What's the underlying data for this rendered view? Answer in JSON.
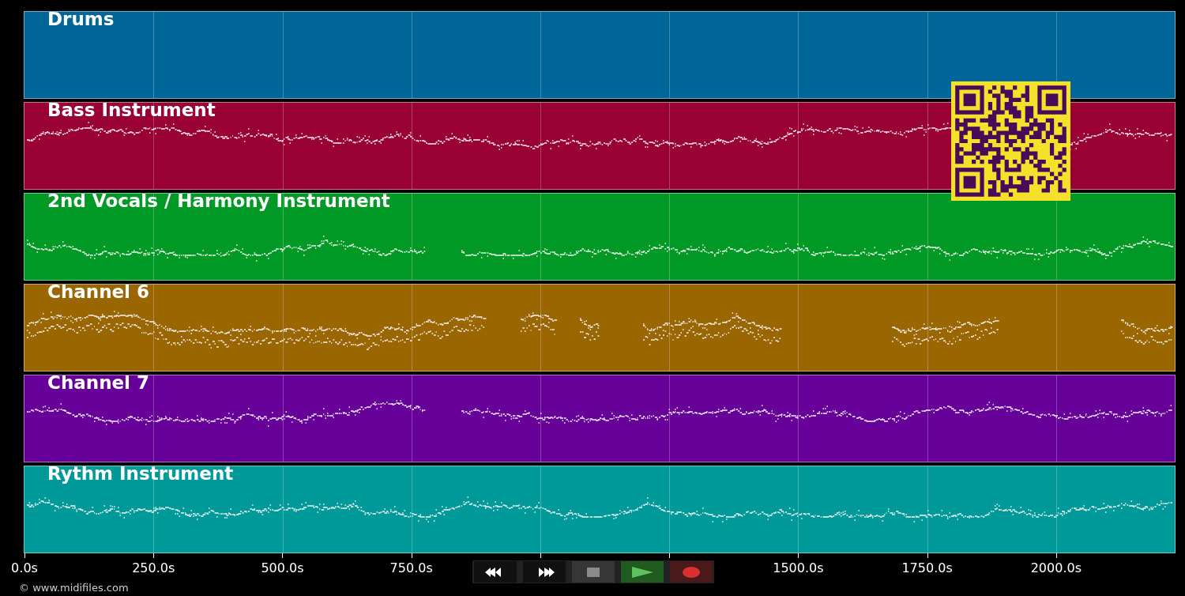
{
  "tracks": [
    {
      "name": "Drums",
      "color": "#006699",
      "has_notes": false
    },
    {
      "name": "Bass Instrument",
      "color": "#990033",
      "has_notes": true
    },
    {
      "name": "2nd Vocals / Harmony Instrument",
      "color": "#009926",
      "has_notes": true
    },
    {
      "name": "Channel 6",
      "color": "#996600",
      "has_notes": true
    },
    {
      "name": "Channel 7",
      "color": "#660099",
      "has_notes": true
    },
    {
      "name": "Rythm Instrument",
      "color": "#009999",
      "has_notes": true
    }
  ],
  "time_axis": {
    "labels_left_of_transport": [
      "0.0s",
      "250.0s",
      "500.0s",
      "750.0s"
    ],
    "labels_right_of_transport": [
      "1500.0s",
      "1750.0s",
      "2000.0s"
    ]
  },
  "transport": [
    {
      "kind": "rewind"
    },
    {
      "kind": "forward"
    },
    {
      "kind": "stop"
    },
    {
      "kind": "play"
    },
    {
      "kind": "record"
    }
  ],
  "copyright": "© www.midifiles.com"
}
